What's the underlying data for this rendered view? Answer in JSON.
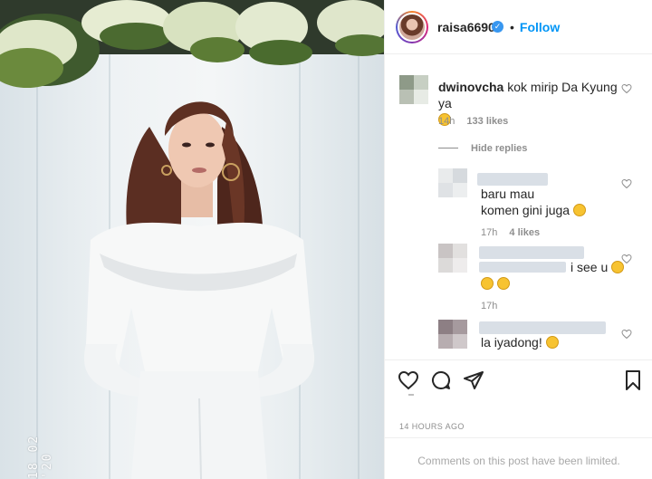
{
  "header": {
    "username": "raisa6690",
    "verified_icon": "verified-badge-icon",
    "follow_label": "Follow",
    "accent": "#0095f6"
  },
  "comments": [
    {
      "author": "dwinovcha",
      "text": "kok mirip Da Kyung ya",
      "emoji": "grinning-sweat-emoji",
      "time": "14h",
      "likes": "133 likes"
    }
  ],
  "replies_toggle": "Hide replies",
  "replies": [
    {
      "author_visible": "",
      "text_line1": "baru mau",
      "text_line2": "komen gini juga",
      "emoji": "grinning-sweat-emoji",
      "time": "17h",
      "likes": "4 likes"
    },
    {
      "author_visible": "",
      "text_line1": "i see u",
      "emoji_line2": [
        "rolling-laughing-emoji",
        "rolling-laughing-emoji"
      ],
      "time": "17h"
    },
    {
      "author_visible": "",
      "text_line1": "",
      "text_line2": "la iyadong!",
      "emoji": "crying-emoji"
    }
  ],
  "actions": {
    "like_icon": "heart-icon",
    "comment_icon": "comment-icon",
    "share_icon": "share-icon",
    "save_icon": "bookmark-icon"
  },
  "post_time": "14 HOURS AGO",
  "limited_notice": "Comments on this post have been limited.",
  "photo": {
    "stamp": "18 02 '20"
  }
}
